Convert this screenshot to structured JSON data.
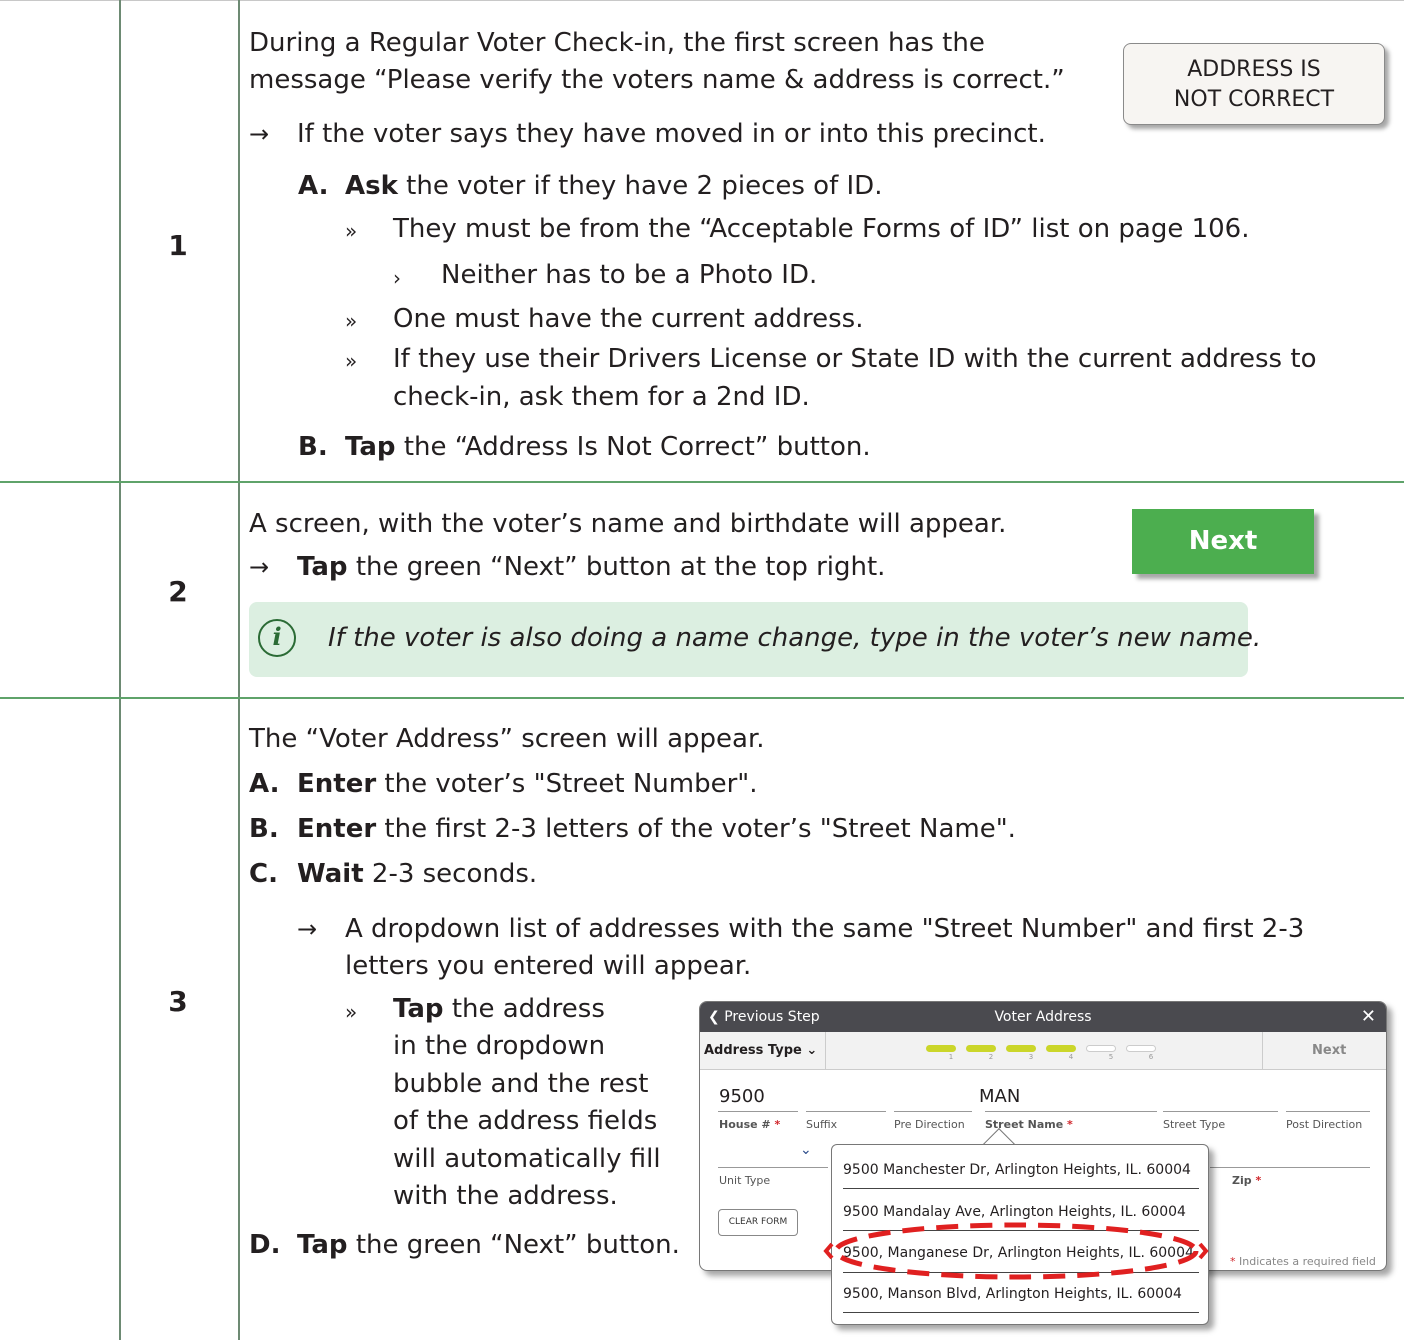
{
  "steps": [
    {
      "number": "1",
      "intro_line1": "During a Regular Voter Check-in, the first screen has the",
      "intro_line2": "message “Please verify the voters name & address is correct.”",
      "arrow_text": "If the voter says they have moved in or into this precinct.",
      "a_letter": "A.",
      "a_bold": "Ask",
      "a_text": "the voter if they have 2 pieces of ID.",
      "a_bullet1": "They must be from the “Acceptable Forms of ID” list on page 106.",
      "a_sub1": "Neither has to be a Photo ID.",
      "a_bullet2": "One must have the current address.",
      "a_bullet3_line1": "If they use their Drivers License or State ID with the current address to",
      "a_bullet3_line2": "check-in, ask them for a 2nd ID.",
      "b_letter": "B.",
      "b_bold": "Tap",
      "b_text": "the “Address Is Not Correct” button.",
      "button_line1": "ADDRESS IS",
      "button_line2": "NOT CORRECT"
    },
    {
      "number": "2",
      "intro": "A screen, with the voter’s name and birthdate will appear.",
      "arrow_bold": "Tap",
      "arrow_text": "the green “Next” button at the top right.",
      "button_label": "Next",
      "note": "If the voter is also doing a name change, type in the voter’s new name.",
      "note_icon": "info-icon"
    },
    {
      "number": "3",
      "intro": "The “Voter Address” screen will appear.",
      "a_letter": "A.",
      "a_bold": "Enter",
      "a_text": "the voter’s \"Street Number\".",
      "b_letter": "B.",
      "b_bold": "Enter",
      "b_text": "the first 2-3 letters of the voter’s \"Street Name\".",
      "c_letter": "C.",
      "c_bold": "Wait",
      "c_text": "2-3 seconds.",
      "c_arrow_line1": "A dropdown list of addresses with the same \"Street Number\" and first 2-3",
      "c_arrow_line2": "letters you entered will appear.",
      "c_tap_bold": "Tap",
      "c_tap_l1": "the address",
      "c_tap_l2": "in the dropdown",
      "c_tap_l3": "bubble and the rest",
      "c_tap_l4": "of the address fields",
      "c_tap_l5": "will automatically fill",
      "c_tap_l6": "with the address.",
      "d_letter": "D.",
      "d_bold": "Tap",
      "d_text": "the green “Next” button."
    }
  ],
  "symbols": {
    "arrow": "→",
    "bullet": "»",
    "sub_bullet": "›"
  },
  "screenshot": {
    "previous_step": "Previous Step",
    "title": "Voter Address",
    "close": "✕",
    "address_type": "Address Type",
    "next": "Next",
    "progress_labels": [
      "1",
      "2",
      "3",
      "4",
      "5",
      "6"
    ],
    "progress_completed": 4,
    "house_value": "9500",
    "street_value": "MAN",
    "labels": {
      "house": "House #",
      "suffix": "Suffix",
      "pre_direction": "Pre Direction",
      "street_name": "Street Name",
      "street_type": "Street Type",
      "post_direction": "Post Direction",
      "unit_type": "Unit Type",
      "zip": "Zip",
      "required": "*"
    },
    "clear_form": "CLEAR FORM",
    "required_note": "Indicates a required field",
    "dropdown": [
      "9500 Manchester Dr, Arlington Heights, IL. 60004",
      "9500 Mandalay Ave, Arlington Heights, IL. 60004",
      "9500, Manganese Dr, Arlington Heights, IL. 60004",
      "9500, Manson Blvd, Arlington Heights, IL. 60004"
    ],
    "highlighted_index": 2,
    "highlight_color": "#e02020",
    "progress_color": "#cbd62a"
  },
  "colors": {
    "next_green": "#4cae4f",
    "note_bg": "#dcefe1",
    "divider_green": "#5fa36a"
  }
}
